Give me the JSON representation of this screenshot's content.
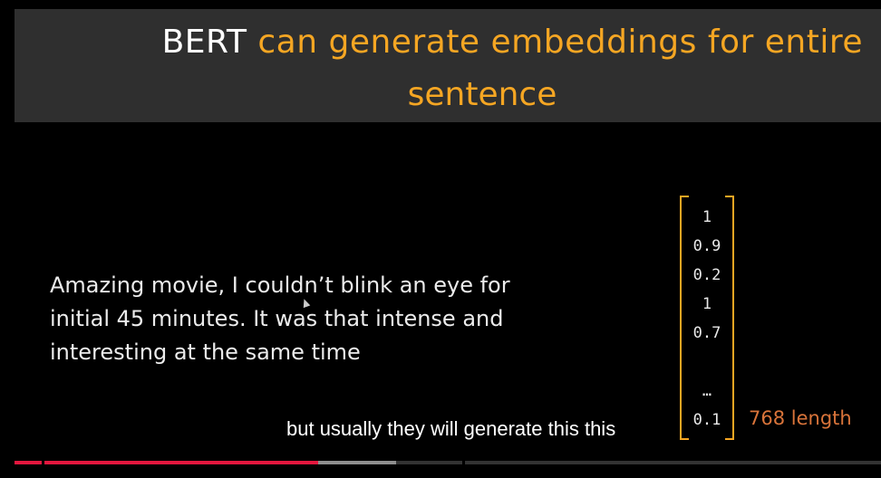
{
  "slide": {
    "title": {
      "word_white": "BERT",
      "rest_line1": " can generate embeddings for entire",
      "line2": "sentence"
    },
    "body_lines": [
      "Amazing movie, I couldn’t blink an eye for",
      "initial 45 minutes. It was that intense and",
      "interesting at the same time"
    ],
    "vector_values": [
      "1",
      "0.9",
      "0.2",
      "1",
      "0.7",
      "…",
      "0.1"
    ],
    "vector_length_label": "768 length"
  },
  "player": {
    "caption": "but usually they will generate this this",
    "progress_played": 0.35,
    "progress_buffered": 0.44
  },
  "colors": {
    "title_bg": "#2f2f2f",
    "accent_orange": "#f5a623",
    "length_orange": "#d9743a",
    "progress_red": "#e4173e"
  }
}
